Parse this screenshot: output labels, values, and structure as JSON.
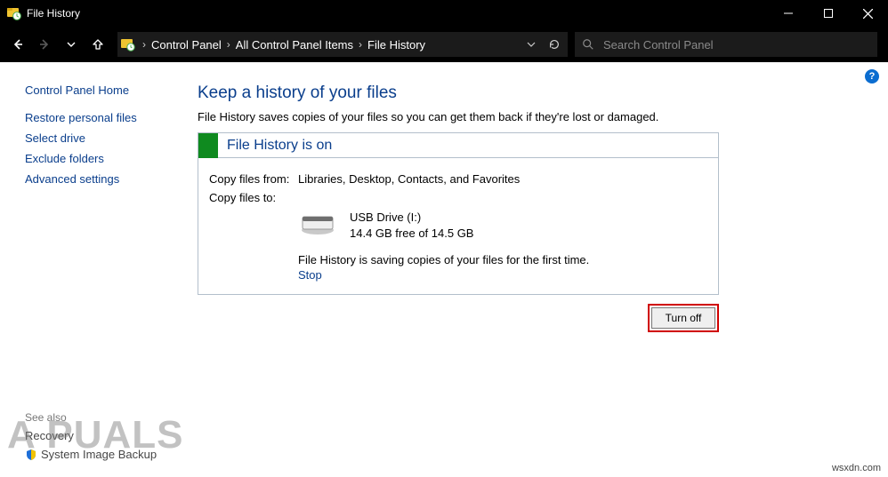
{
  "titlebar": {
    "title": "File History"
  },
  "breadcrumb": {
    "items": [
      "Control Panel",
      "All Control Panel Items",
      "File History"
    ]
  },
  "search": {
    "placeholder": "Search Control Panel"
  },
  "sidebar": {
    "home": "Control Panel Home",
    "tasks": [
      "Restore personal files",
      "Select drive",
      "Exclude folders",
      "Advanced settings"
    ],
    "see_also_label": "See also",
    "see_also": [
      "Recovery",
      "System Image Backup"
    ]
  },
  "main": {
    "heading": "Keep a history of your files",
    "subtitle": "File History saves copies of your files so you can get them back if they're lost or damaged.",
    "panel_title": "File History is on",
    "copy_from_label": "Copy files from:",
    "copy_from_value": "Libraries, Desktop, Contacts, and Favorites",
    "copy_to_label": "Copy files to:",
    "drive_name": "USB Drive (I:)",
    "drive_space": "14.4 GB free of 14.5 GB",
    "status": "File History is saving copies of your files for the first time.",
    "stop_label": "Stop",
    "turn_off_label": "Turn off"
  },
  "help": {
    "glyph": "?"
  },
  "watermark": {
    "text": "A   PUALS",
    "credit": "wsxdn.com"
  }
}
